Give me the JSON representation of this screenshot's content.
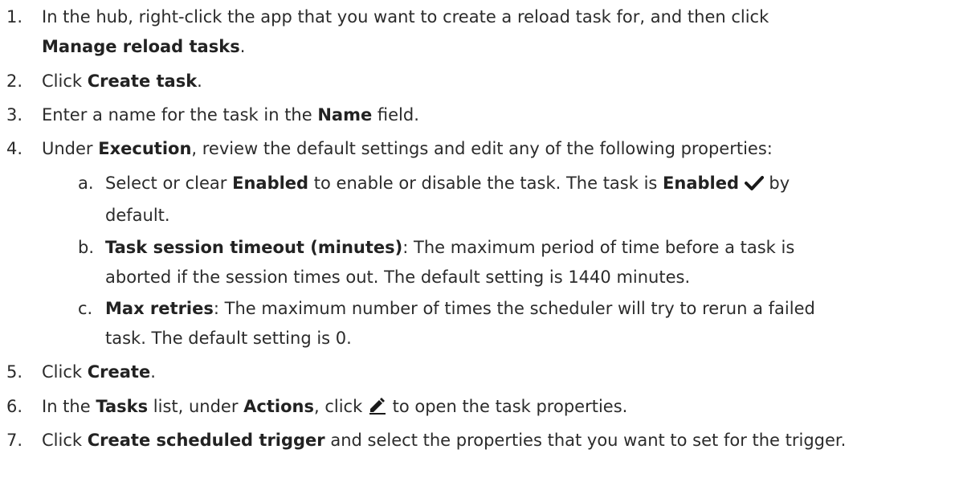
{
  "steps": [
    {
      "n": "1.",
      "t1": "In the hub, right-click the app that you want to create a reload task for, and then click",
      "b1": "Manage reload tasks",
      "t2": "."
    },
    {
      "n": "2.",
      "t1": "Click ",
      "b1": "Create task",
      "t2": "."
    },
    {
      "n": "3.",
      "t1": "Enter a name for the task in the ",
      "b1": "Name",
      "t2": " field."
    },
    {
      "n": "4.",
      "t1": "Under ",
      "b1": "Execution",
      "t2": ", review the default settings and edit any of the following properties:"
    },
    {
      "n": "5.",
      "t1": "Click ",
      "b1": "Create",
      "t2": "."
    },
    {
      "n": "6.",
      "t1": "In the ",
      "b1": "Tasks",
      "t2": " list, under ",
      "b2": "Actions",
      "t3": ", click ",
      "t4": " to open the task properties."
    },
    {
      "n": "7.",
      "t1": "Click ",
      "b1": "Create scheduled trigger",
      "t2": " and select the properties that you want to set for the trigger."
    }
  ],
  "substeps": [
    {
      "n": "a.",
      "t1": "Select or clear ",
      "b1": "Enabled",
      "t2": " to enable or disable the task. The task is ",
      "b2": "Enabled",
      "t3": " by",
      "t4": "default."
    },
    {
      "n": "b.",
      "b1": "Task session timeout (minutes)",
      "t1": ": The maximum period of time before a task is",
      "t2": "aborted if the session times out. The default setting is 1440 minutes."
    },
    {
      "n": "c.",
      "b1": "Max retries",
      "t1": ": The maximum number of times the scheduler will try to rerun a failed",
      "t2": "task. The default setting is 0."
    }
  ],
  "icons": {
    "check": "checkmark-icon",
    "edit": "pencil-edit-icon"
  }
}
